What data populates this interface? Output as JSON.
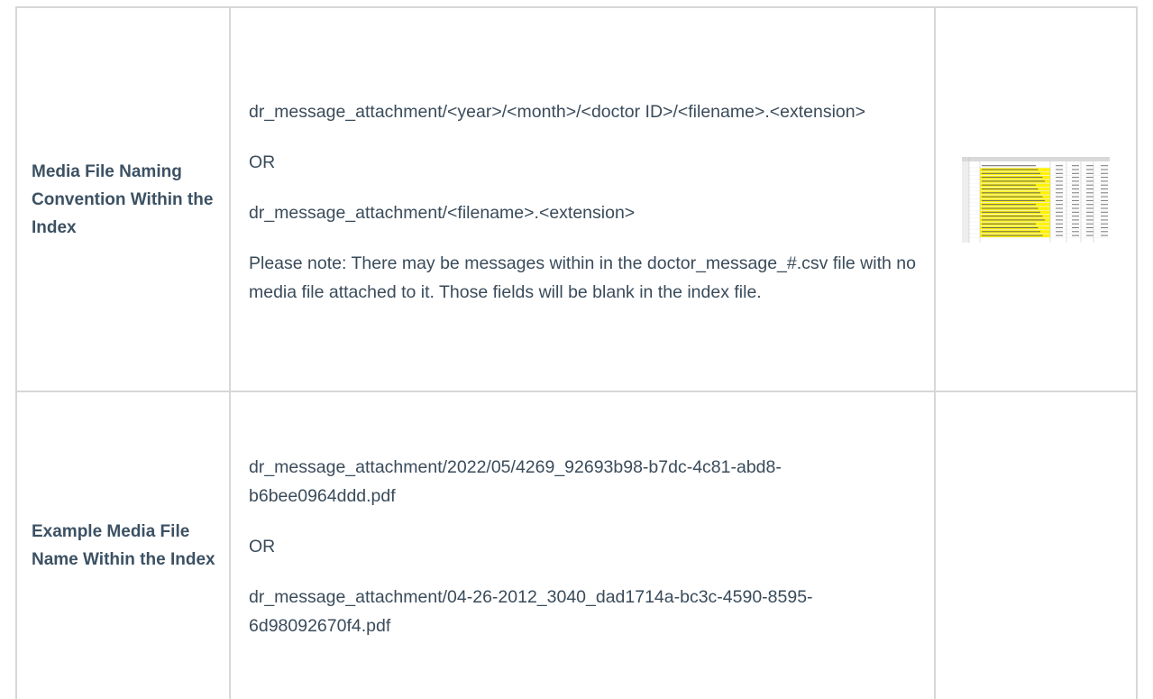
{
  "rows": [
    {
      "label": "Media File Naming Convention Within the Index",
      "content": [
        "dr_message_attachment/<year>/<month>/<doctor ID>/<filename>.<extension>",
        "OR",
        "dr_message_attachment/<filename>.<extension>",
        "Please note: There may be messages within in the doctor_message_#.csv file with no media file attached to it. Those fields will be blank in the index file."
      ],
      "image": {
        "description_icon": "spreadsheet-screenshot-icon",
        "highlight_color": "#fff200"
      }
    },
    {
      "label": "Example Media File Name Within the Index",
      "content": [
        "dr_message_attachment/2022/05/4269_92693b98-b7dc-4c81-abd8-b6bee0964ddd.pdf",
        "OR",
        "dr_message_attachment/04-26-2012_3040_dad1714a-bc3c-4590-8595-6d98092670f4.pdf"
      ]
    }
  ],
  "colors": {
    "border": "#d7d7d7",
    "text": "#3a4b5a",
    "label": "#3c5163"
  }
}
